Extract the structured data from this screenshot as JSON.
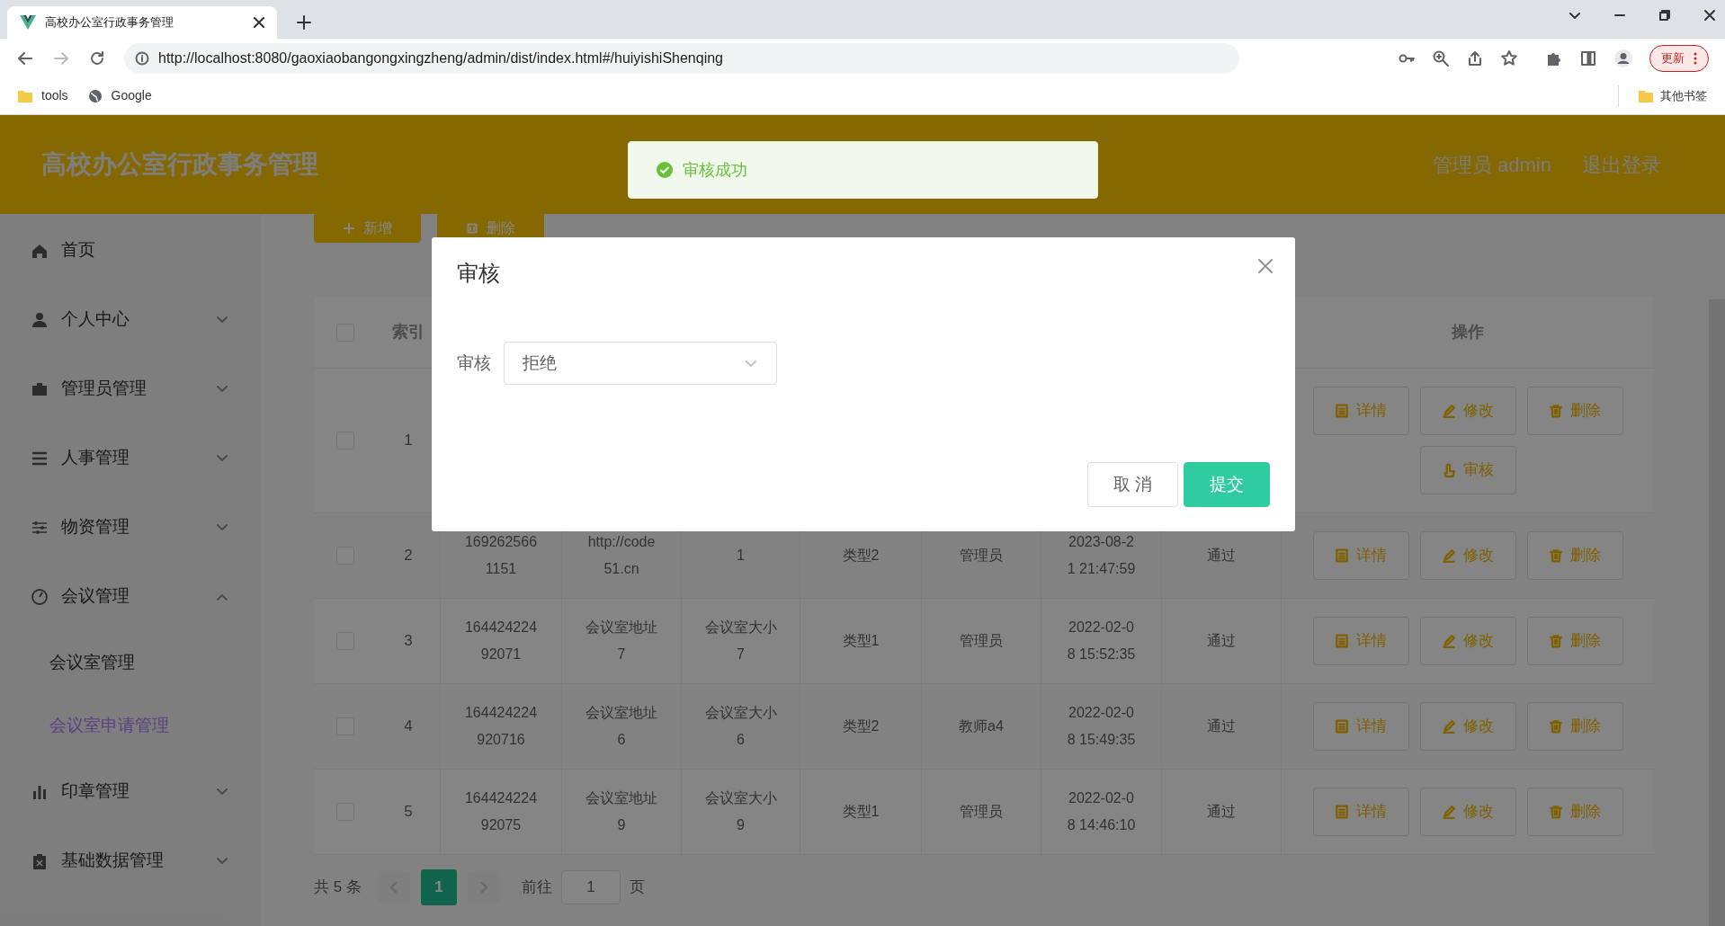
{
  "browser": {
    "tab_title": "高校办公室行政事务管理",
    "url": "http://localhost:8080/gaoxiaobangongxingzheng/admin/dist/index.html#/huiyishiShenqing",
    "bookmarks": [
      "tools",
      "Google"
    ],
    "other_bookmarks": "其他书签",
    "update_button": "更新"
  },
  "header": {
    "title": "高校办公室行政事务管理",
    "user": "管理员 admin",
    "logout": "退出登录"
  },
  "toast": {
    "kind": "success",
    "message": "审核成功"
  },
  "sidebar": {
    "items": [
      {
        "label": "首页"
      },
      {
        "label": "个人中心",
        "expanded": false
      },
      {
        "label": "管理员管理",
        "expanded": false
      },
      {
        "label": "人事管理",
        "expanded": false
      },
      {
        "label": "物资管理",
        "expanded": false
      },
      {
        "label": "会议管理",
        "expanded": true,
        "children": [
          {
            "label": "会议室管理",
            "selected": false
          },
          {
            "label": "会议室申请管理",
            "selected": true
          }
        ]
      },
      {
        "label": "印章管理",
        "expanded": false
      },
      {
        "label": "基础数据管理",
        "expanded": false
      }
    ]
  },
  "toolbar": [
    {
      "kind": "add",
      "label": "新增"
    },
    {
      "kind": "delete",
      "label": "删除"
    }
  ],
  "table": {
    "select_all": {
      "checked": false
    },
    "columns": [
      "索引",
      "操作"
    ],
    "rows": [
      {
        "checked": false,
        "index": "1",
        "cells": [],
        "actions": [
          "详情",
          "修改",
          "删除",
          "审核"
        ]
      },
      {
        "checked": false,
        "index": "2",
        "cells": [
          "1692625661151",
          "http://code51.cn",
          "1",
          "类型2",
          "管理员",
          "2023-08-21 21:47:59",
          "通过"
        ],
        "actions": [
          "详情",
          "修改",
          "删除"
        ]
      },
      {
        "checked": false,
        "index": "3",
        "cells": [
          "16442422492071",
          "会议室地址7",
          "会议室大小7",
          "类型1",
          "管理员",
          "2022-02-08 15:52:35",
          "通过"
        ],
        "actions": [
          "详情",
          "修改",
          "删除"
        ]
      },
      {
        "checked": false,
        "index": "4",
        "cells": [
          "164424224920716",
          "会议室地址6",
          "会议室大小6",
          "类型2",
          "教师a4",
          "2022-02-08 15:49:35",
          "通过"
        ],
        "actions": [
          "详情",
          "修改",
          "删除"
        ]
      },
      {
        "checked": false,
        "index": "5",
        "cells": [
          "16442422492075",
          "会议室地址9",
          "会议室大小9",
          "类型1",
          "管理员",
          "2022-02-08 14:46:10",
          "通过"
        ],
        "actions": [
          "详情",
          "修改",
          "删除"
        ]
      }
    ]
  },
  "pagination": {
    "total": "共 5 条",
    "pages": [
      {
        "label": "1",
        "selected": true
      }
    ],
    "goto_label": "前往",
    "goto_value": "1",
    "page_unit": "页"
  },
  "dialog": {
    "title": "审核",
    "field_label": "审核",
    "field_value": "拒绝",
    "buttons": [
      {
        "kind": "cancel",
        "label": "取 消"
      },
      {
        "kind": "primary",
        "label": "提交"
      }
    ]
  }
}
